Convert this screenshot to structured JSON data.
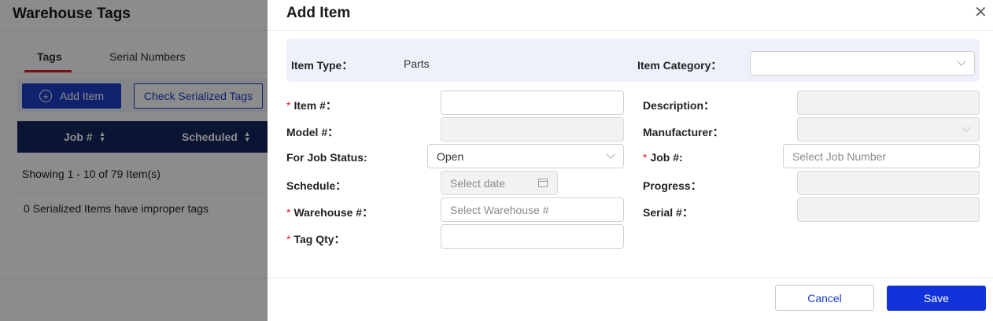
{
  "background": {
    "title": "Warehouse Tags",
    "tabs": [
      {
        "label": "Tags"
      },
      {
        "label": "Serial Numbers"
      }
    ],
    "toolbar": {
      "add_label": "Add Item",
      "check_label": "Check Serialized Tags"
    },
    "table": {
      "columns": [
        "Job #",
        "Scheduled"
      ],
      "showing": "Showing 1 - 10 of 79 Item(s)",
      "improper": "0 Serialized Items have improper tags"
    }
  },
  "drawer": {
    "title": "Add Item",
    "close_glyph": "✕",
    "item_type_label": "Item Type：",
    "item_type_value": "Parts",
    "item_category_label": "Item Category：",
    "item_category_value": "",
    "fields": {
      "item_no_label": "Item #：",
      "item_no_value": "",
      "description_label": "Description：",
      "model_label": "Model #：",
      "manufacturer_label": "Manufacturer：",
      "job_status_label": "For Job Status:",
      "job_status_value": "Open",
      "job_label": "Job #:",
      "job_placeholder": "Select Job Number",
      "schedule_label": "Schedule：",
      "schedule_placeholder": "Select date",
      "progress_label": "Progress：",
      "warehouse_label": "Warehouse #：",
      "warehouse_placeholder": "Select Warehouse #",
      "serial_label": "Serial #：",
      "tag_qty_label": "Tag Qty：",
      "tag_qty_value": ""
    },
    "footer": {
      "cancel_label": "Cancel",
      "save_label": "Save"
    }
  },
  "colors": {
    "primary": "#1e3ec9",
    "required": "#e0242f",
    "table_header": "#13265e",
    "panel_bg": "#eef1fb"
  },
  "icons": {
    "add": "plus-circle-icon",
    "sort": "sort-icon",
    "close": "close-icon",
    "dropdown": "chevron-down-icon",
    "calendar": "calendar-icon"
  }
}
